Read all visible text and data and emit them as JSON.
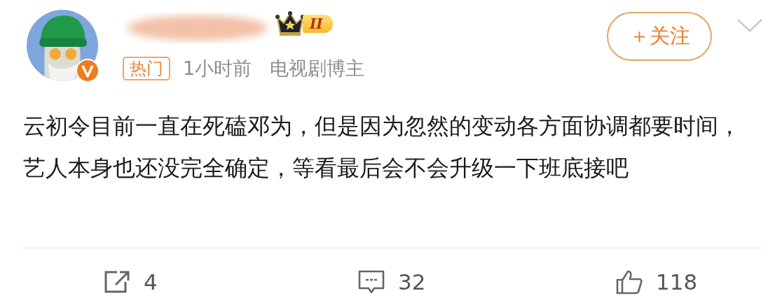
{
  "post": {
    "author": {
      "level_badge": "II",
      "verified": true
    },
    "tag": "热门",
    "time": "1小时前",
    "author_type": "电视剧博主",
    "follow_button": "＋关注",
    "text": "云初令目前一直在死磕邓为，但是因为忽然的变动各方面协调都要时间，艺人本身也还没完全确定，等看最后会不会升级一下班底接吧",
    "actions": [
      {
        "kind": "share",
        "count": "4"
      },
      {
        "kind": "comment",
        "count": "32"
      },
      {
        "kind": "like",
        "count": "118"
      }
    ]
  }
}
